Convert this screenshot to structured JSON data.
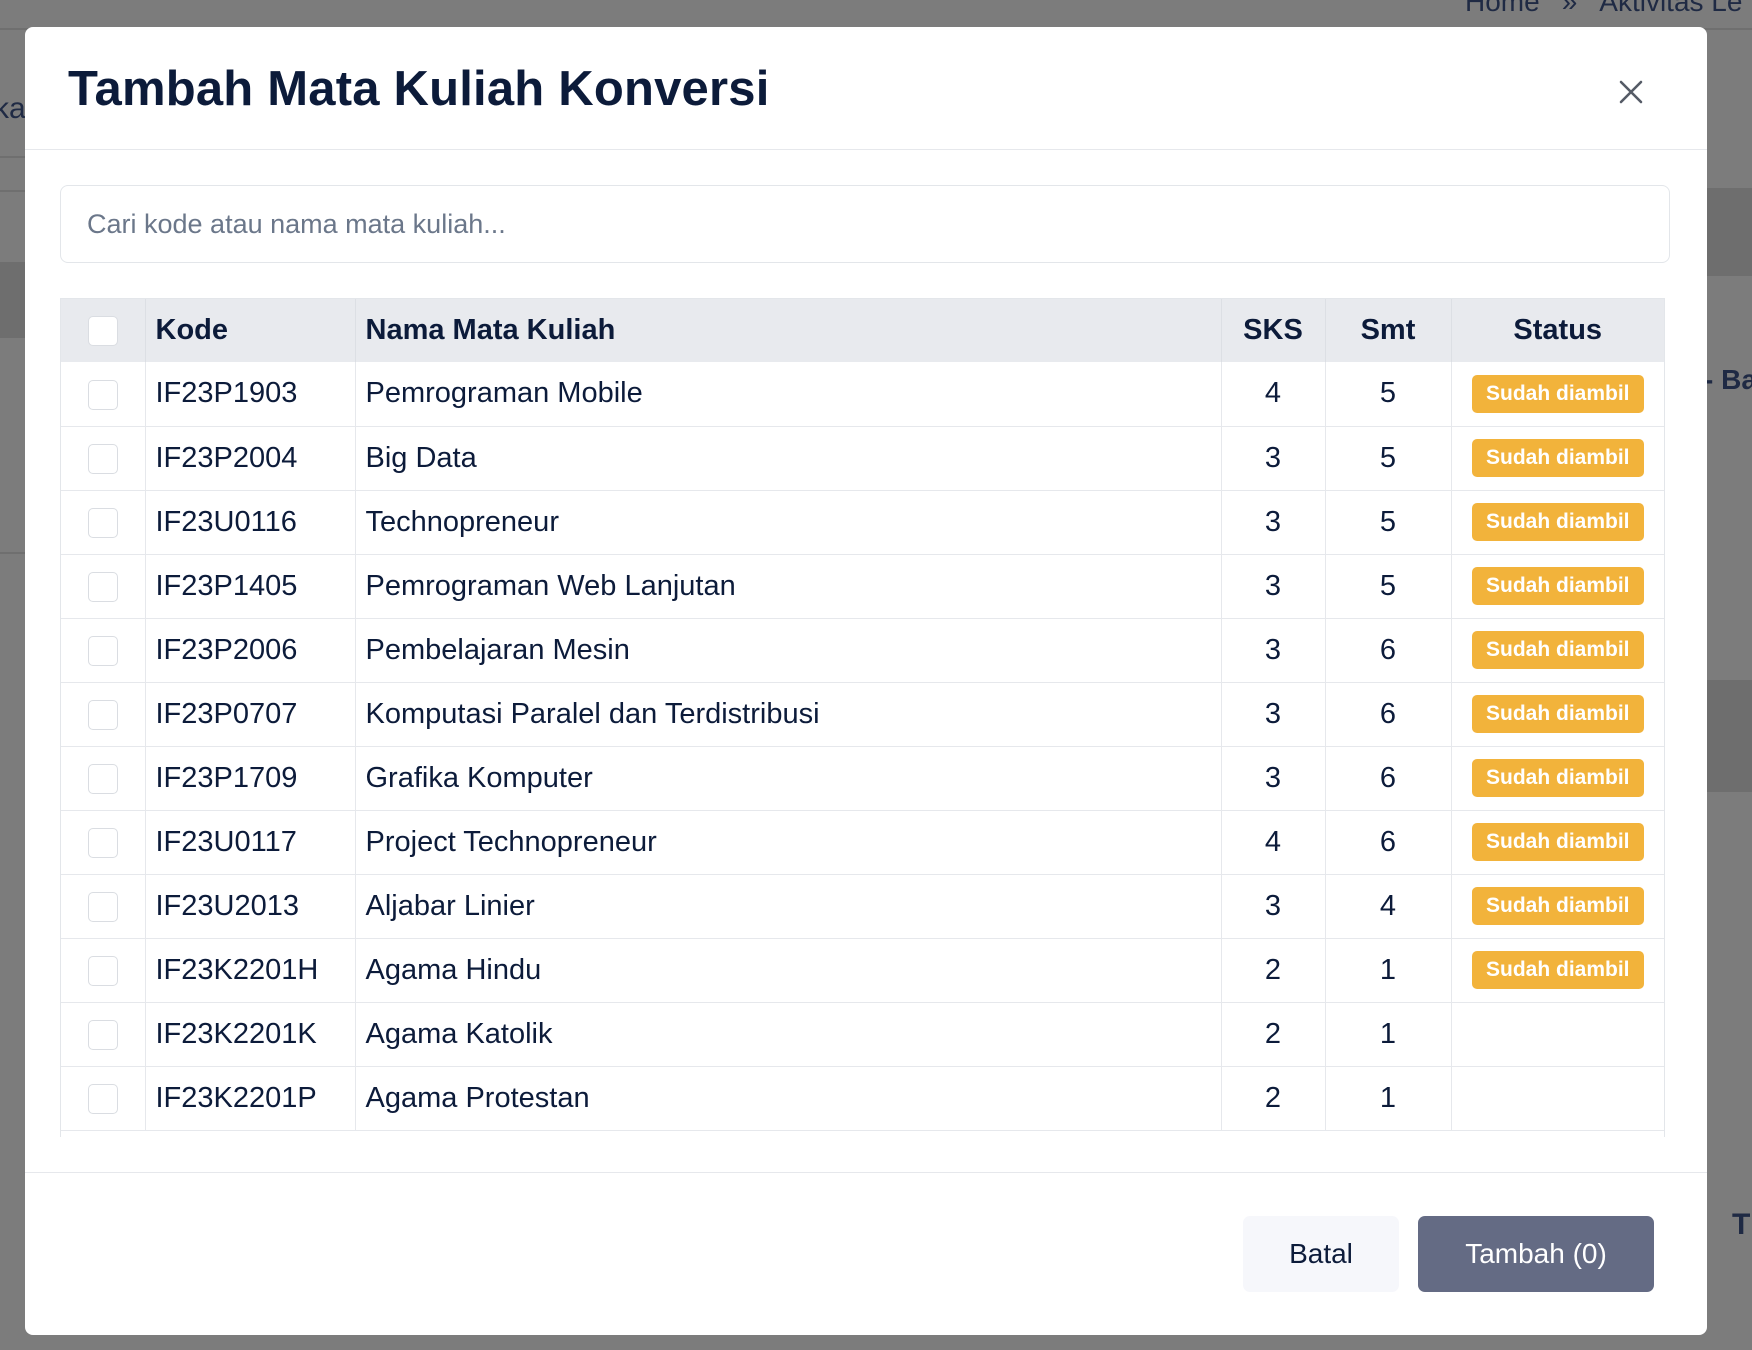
{
  "background": {
    "breadcrumb": [
      "Home",
      "»",
      "Aktivitas Le"
    ],
    "fragments": [
      "ka",
      "- Ba",
      "T"
    ]
  },
  "modal": {
    "title": "Tambah Mata Kuliah Konversi",
    "search": {
      "placeholder": "Cari kode atau nama mata kuliah...",
      "value": ""
    },
    "columns": {
      "kode": "Kode",
      "nama": "Nama Mata Kuliah",
      "sks": "SKS",
      "smt": "Smt",
      "status": "Status"
    },
    "rows": [
      {
        "kode": "IF23P1903",
        "nama": "Pemrograman Mobile",
        "sks": "4",
        "smt": "5",
        "status": "Sudah diambil"
      },
      {
        "kode": "IF23P2004",
        "nama": "Big Data",
        "sks": "3",
        "smt": "5",
        "status": "Sudah diambil"
      },
      {
        "kode": "IF23U0116",
        "nama": "Technopreneur",
        "sks": "3",
        "smt": "5",
        "status": "Sudah diambil"
      },
      {
        "kode": "IF23P1405",
        "nama": "Pemrograman Web Lanjutan",
        "sks": "3",
        "smt": "5",
        "status": "Sudah diambil"
      },
      {
        "kode": "IF23P2006",
        "nama": "Pembelajaran Mesin",
        "sks": "3",
        "smt": "6",
        "status": "Sudah diambil"
      },
      {
        "kode": "IF23P0707",
        "nama": "Komputasi Paralel dan Terdistribusi",
        "sks": "3",
        "smt": "6",
        "status": "Sudah diambil"
      },
      {
        "kode": "IF23P1709",
        "nama": "Grafika Komputer",
        "sks": "3",
        "smt": "6",
        "status": "Sudah diambil"
      },
      {
        "kode": "IF23U0117",
        "nama": "Project Technopreneur",
        "sks": "4",
        "smt": "6",
        "status": "Sudah diambil"
      },
      {
        "kode": "IF23U2013",
        "nama": "Aljabar Linier",
        "sks": "3",
        "smt": "4",
        "status": "Sudah diambil"
      },
      {
        "kode": "IF23K2201H",
        "nama": "Agama Hindu",
        "sks": "2",
        "smt": "1",
        "status": "Sudah diambil"
      },
      {
        "kode": "IF23K2201K",
        "nama": "Agama Katolik",
        "sks": "2",
        "smt": "1",
        "status": ""
      },
      {
        "kode": "IF23K2201P",
        "nama": "Agama Protestan",
        "sks": "2",
        "smt": "1",
        "status": ""
      }
    ],
    "footer": {
      "cancel_label": "Batal",
      "submit_label": "Tambah (0)"
    }
  },
  "colors": {
    "badge": "#f2b33b",
    "primary_button": "#646b84",
    "title": "#0c1b3a"
  },
  "icons": {
    "close": "close-icon"
  }
}
